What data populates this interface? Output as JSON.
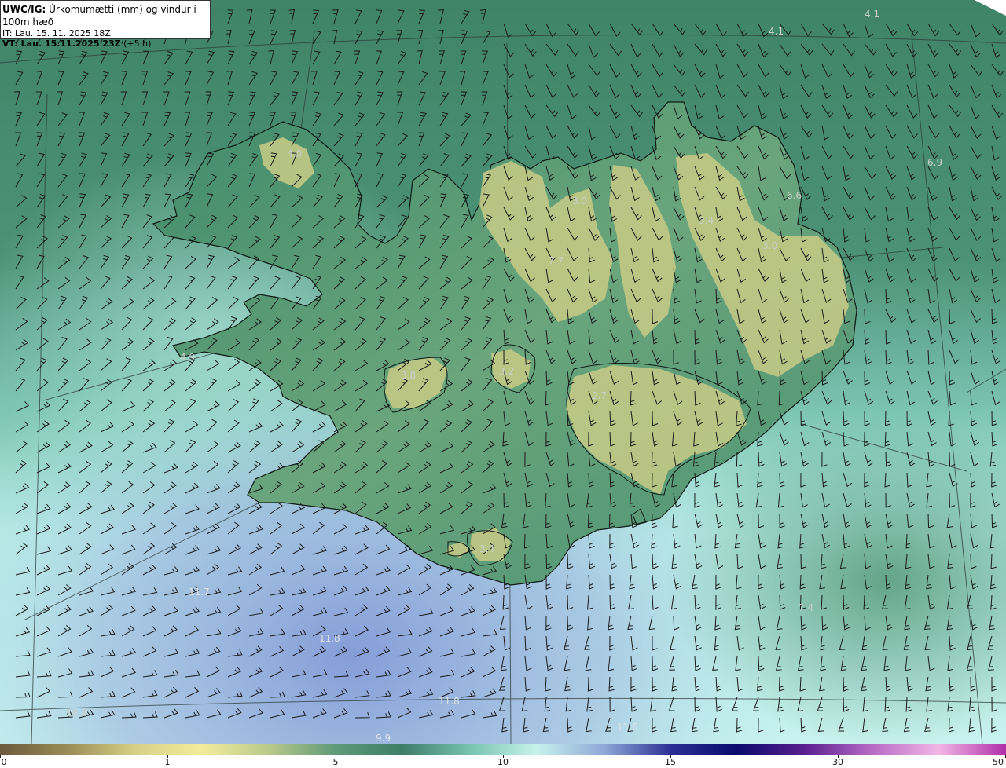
{
  "header": {
    "model": "UWC/IG:",
    "title": "Úrkomumætti (mm) og vindur í 100m hæð",
    "init_time": "IT: Lau. 15. 11. 2025 18Z",
    "valid_time_label": "VT: Lau. 15.11.2025 23Z",
    "lead": "(+5 h)"
  },
  "map": {
    "region": "Iceland",
    "variable": "Úrkomumætti (mm)",
    "wind_symbol": "wind-barbs",
    "land_color": "#d9d79a",
    "sea_low_color": "#4d8e74",
    "sea_high_color": "#b8ece8",
    "value_labels": [
      {
        "id": "v41a",
        "text": "4.1"
      },
      {
        "id": "v41b",
        "text": "4.1"
      },
      {
        "id": "v40",
        "text": "4.0"
      },
      {
        "id": "v69",
        "text": "6.9"
      },
      {
        "id": "v66",
        "text": "6.6"
      },
      {
        "id": "v30a",
        "text": "3.0"
      },
      {
        "id": "v34a",
        "text": "3.4"
      },
      {
        "id": "v30b",
        "text": "3.0"
      },
      {
        "id": "v77",
        "text": "7.7"
      },
      {
        "id": "v49",
        "text": "4.9"
      },
      {
        "id": "v38",
        "text": "3.8"
      },
      {
        "id": "v32",
        "text": "3.2"
      },
      {
        "id": "v27",
        "text": "2.7"
      },
      {
        "id": "v34b",
        "text": "3.4"
      },
      {
        "id": "v117",
        "text": "11.7"
      },
      {
        "id": "v118a",
        "text": "11.8"
      },
      {
        "id": "v118b",
        "text": "11.8"
      },
      {
        "id": "v74",
        "text": "7.4"
      },
      {
        "id": "v104",
        "text": "10.4"
      },
      {
        "id": "v99",
        "text": "9.9"
      },
      {
        "id": "v116",
        "text": "11.6"
      }
    ]
  },
  "colorbar": {
    "labels": [
      "0",
      "1",
      "5",
      "10",
      "15",
      "30",
      "50"
    ],
    "colors": [
      "#6b5a3c",
      "#9a8c55",
      "#d6cf86",
      "#f3ec9c",
      "#b9c98a",
      "#5f9a78",
      "#3d7e68",
      "#77c2b0",
      "#c6f2ec",
      "#8fa9d8",
      "#2b2f94",
      "#0a0a6e",
      "#5a1f8f",
      "#b86bc6",
      "#f2b6e6",
      "#b12fa8"
    ]
  }
}
